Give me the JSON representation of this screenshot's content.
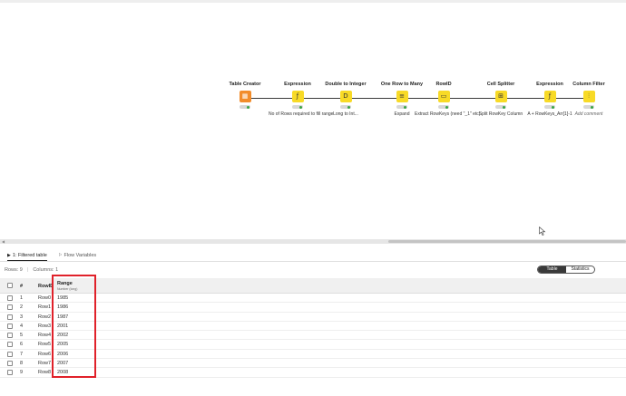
{
  "workflow": {
    "nodes": [
      {
        "title": "Table Creator",
        "desc": "",
        "icon": "table-creator-icon",
        "glyph": "▦",
        "color": "#f28c2b"
      },
      {
        "title": "Expression",
        "desc": "No of Rows required to fill range",
        "icon": "expression-icon",
        "glyph": "ƒ",
        "color": "#f8da26"
      },
      {
        "title": "Double to Integer",
        "desc": "Long to Int...",
        "icon": "double-to-integer-icon",
        "glyph": "D",
        "color": "#f8da26"
      },
      {
        "title": "One Row to Many",
        "desc": "Expand",
        "icon": "one-row-to-many-icon",
        "glyph": "≡",
        "color": "#f8da26"
      },
      {
        "title": "RowID",
        "desc": "Extract RowKeys (need \"_1\" etc)",
        "icon": "rowid-icon",
        "glyph": "▭",
        "color": "#f8da26"
      },
      {
        "title": "Cell Splitter",
        "desc": "Split RowKey Column",
        "icon": "cell-splitter-icon",
        "glyph": "⊞",
        "color": "#f8da26"
      },
      {
        "title": "Expression",
        "desc": "A + RowKeys_Arr[1]-1",
        "icon": "expression-icon",
        "glyph": "ƒ",
        "color": "#f8da26"
      },
      {
        "title": "Column Filter",
        "desc": "Add comment",
        "icon": "column-filter-icon",
        "glyph": "⫶",
        "color": "#f8da26"
      }
    ]
  },
  "panel": {
    "tabs": [
      {
        "label": "1: Filtered table"
      },
      {
        "label": "Flow Variables"
      }
    ],
    "rows_label": "Rows: 9",
    "columns_label": "Columns: 1",
    "toggle": {
      "table": "Table",
      "statistics": "Statistics"
    }
  },
  "table": {
    "headers": {
      "index": "#",
      "rowid": "RowID",
      "range": "Range",
      "range_type": "Number (long)"
    },
    "rows": [
      {
        "n": "1",
        "id": "Row0",
        "v": "1985"
      },
      {
        "n": "2",
        "id": "Row1",
        "v": "1986"
      },
      {
        "n": "3",
        "id": "Row2",
        "v": "1987"
      },
      {
        "n": "4",
        "id": "Row3",
        "v": "2001"
      },
      {
        "n": "5",
        "id": "Row4",
        "v": "2002"
      },
      {
        "n": "6",
        "id": "Row5",
        "v": "2005"
      },
      {
        "n": "7",
        "id": "Row6",
        "v": "2006"
      },
      {
        "n": "8",
        "id": "Row7",
        "v": "2007"
      },
      {
        "n": "9",
        "id": "Row8",
        "v": "2008"
      }
    ]
  },
  "colors": {
    "highlight": "#e0212a",
    "node_yellow": "#f8da26",
    "node_orange": "#f28c2b",
    "status_green": "#3aa546"
  }
}
